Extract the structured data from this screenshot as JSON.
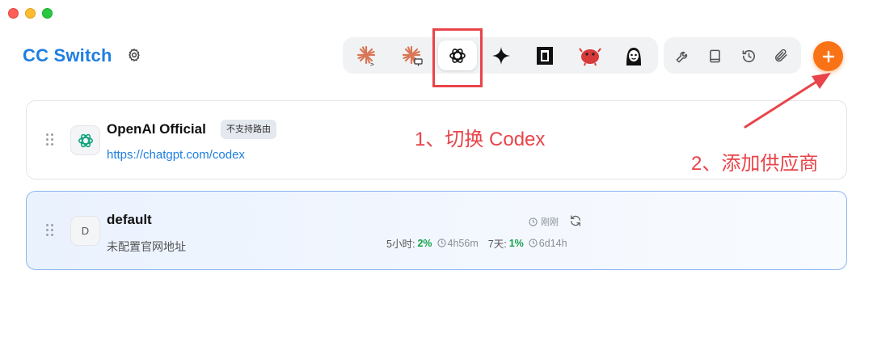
{
  "window": {
    "traffic_lights": [
      "close",
      "minimize",
      "zoom"
    ]
  },
  "header": {
    "title": "CC Switch",
    "settings_icon": "gear-icon"
  },
  "tools": [
    {
      "name": "claude-code-icon",
      "active": false
    },
    {
      "name": "claude-desktop-icon",
      "active": false
    },
    {
      "name": "codex-icon",
      "active": true
    },
    {
      "name": "gemini-icon",
      "active": false
    },
    {
      "name": "opencode-icon",
      "active": false
    },
    {
      "name": "red-mascot-icon",
      "active": false
    },
    {
      "name": "avatar-mascot-icon",
      "active": false
    }
  ],
  "utilities": [
    "wrench-icon",
    "book-icon",
    "history-icon",
    "paperclip-icon"
  ],
  "add_button": {
    "icon": "plus-icon",
    "color": "#f97316"
  },
  "annotations": {
    "step1": "1、切换 Codex",
    "step2": "2、添加供应商",
    "color": "#e8444a"
  },
  "providers": [
    {
      "name": "OpenAI Official",
      "badge": "不支持路由",
      "url": "https://chatgpt.com/codex",
      "icon": "openai-icon",
      "active": false
    },
    {
      "name": "default",
      "initial": "D",
      "description": "未配置官网地址",
      "status_time": "刚刚",
      "active": true,
      "usage": {
        "five_hour_label": "5小时:",
        "five_hour_pct": "2%",
        "five_hour_reset": "4h56m",
        "week_label": "7天:",
        "week_pct": "1%",
        "week_reset": "6d14h"
      }
    }
  ],
  "colors": {
    "accent": "#1f7fe0",
    "usage_green": "#16a34a"
  }
}
